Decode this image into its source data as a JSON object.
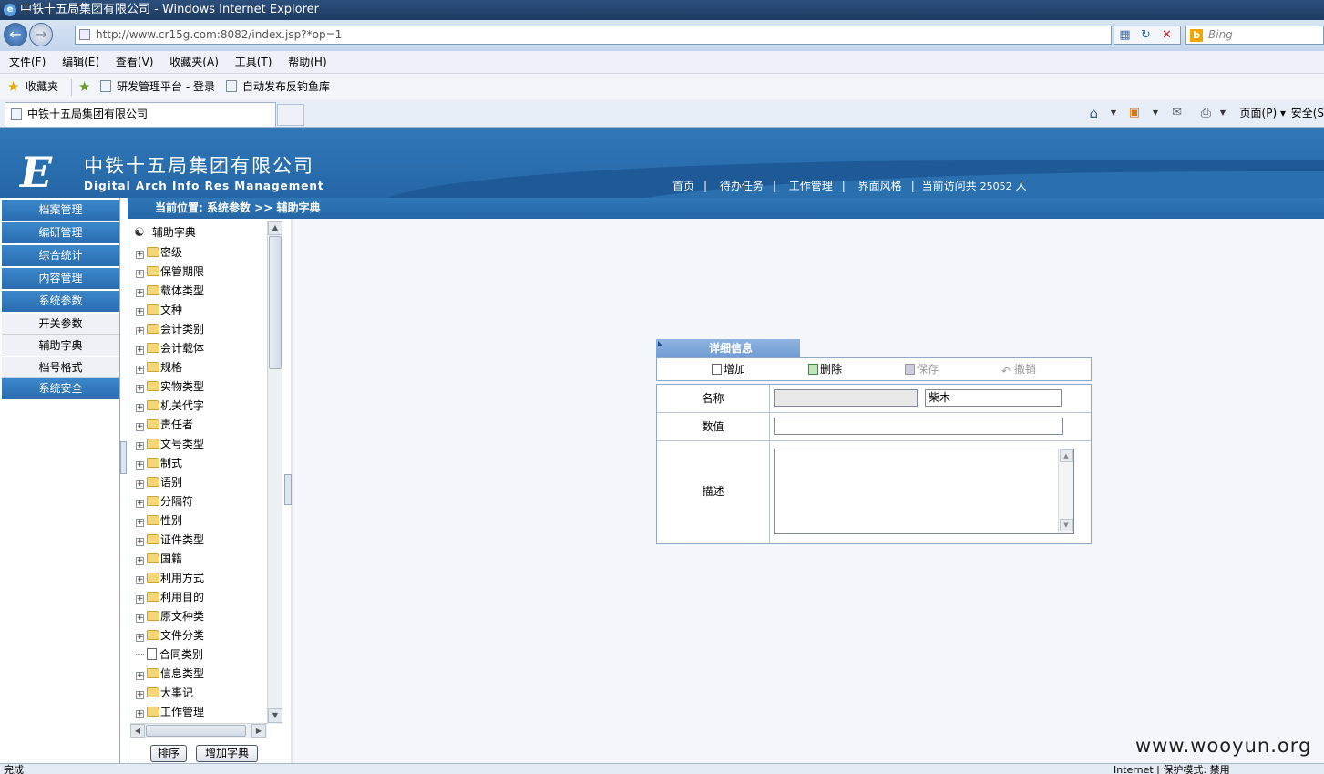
{
  "browser": {
    "window_title": "中铁十五局集团有限公司 - Windows Internet Explorer",
    "url": "http://www.cr15g.com:8082/index.jsp?*op=1",
    "search_placeholder": "Bing",
    "menu": [
      "文件(F)",
      "编辑(E)",
      "查看(V)",
      "收藏夹(A)",
      "工具(T)",
      "帮助(H)"
    ],
    "favorites_label": "收藏夹",
    "fav_links": [
      "研发管理平台 - 登录",
      "自动发布反钓鱼库"
    ],
    "tab_title": "中铁十五局集团有限公司",
    "cmd_page": "页面(P) ▾",
    "cmd_safety": "安全(S",
    "status_left": "完成",
    "status_right": "Internet | 保护模式: 禁用"
  },
  "header": {
    "logo": "E",
    "company": "中铁十五局集团有限公司",
    "subtitle": "Digital Arch Info Res Management",
    "nav": [
      "首页",
      "待办任务",
      "工作管理",
      "界面风格"
    ],
    "visits_prefix": "当前访问共",
    "visits_count": "25052",
    "visits_suffix": "人"
  },
  "sidebar": {
    "items": [
      "档案管理",
      "编研管理",
      "综合统计",
      "内容管理",
      "系统参数"
    ],
    "sub_items": [
      "开关参数",
      "辅助字典",
      "档号格式"
    ],
    "last_item": "系统安全"
  },
  "breadcrumb": "当前位置: 系统参数 >> 辅助字典",
  "tree": {
    "root": "辅助字典",
    "nodes": [
      "密级",
      "保管期限",
      "载体类型",
      "文种",
      "会计类别",
      "会计载体",
      "规格",
      "实物类型",
      "机关代字",
      "责任者",
      "文号类型",
      "制式",
      "语别",
      "分隔符",
      "性别",
      "证件类型",
      "国籍",
      "利用方式",
      "利用目的",
      "原文种类",
      "文件分类",
      "合同类别",
      "信息类型",
      "大事记",
      "工作管理"
    ],
    "sort_button": "排序",
    "add_button": "增加字典"
  },
  "detail": {
    "title": "详细信息",
    "toolbar": {
      "add": "增加",
      "delete": "删除",
      "save": "保存",
      "undo": "撤销"
    },
    "fields": {
      "name_label": "名称",
      "name_code": "",
      "name_value": "柴木",
      "value_label": "数值",
      "value_value": "",
      "desc_label": "描述",
      "desc_value": ""
    }
  },
  "watermark": "www.wooyun.org"
}
